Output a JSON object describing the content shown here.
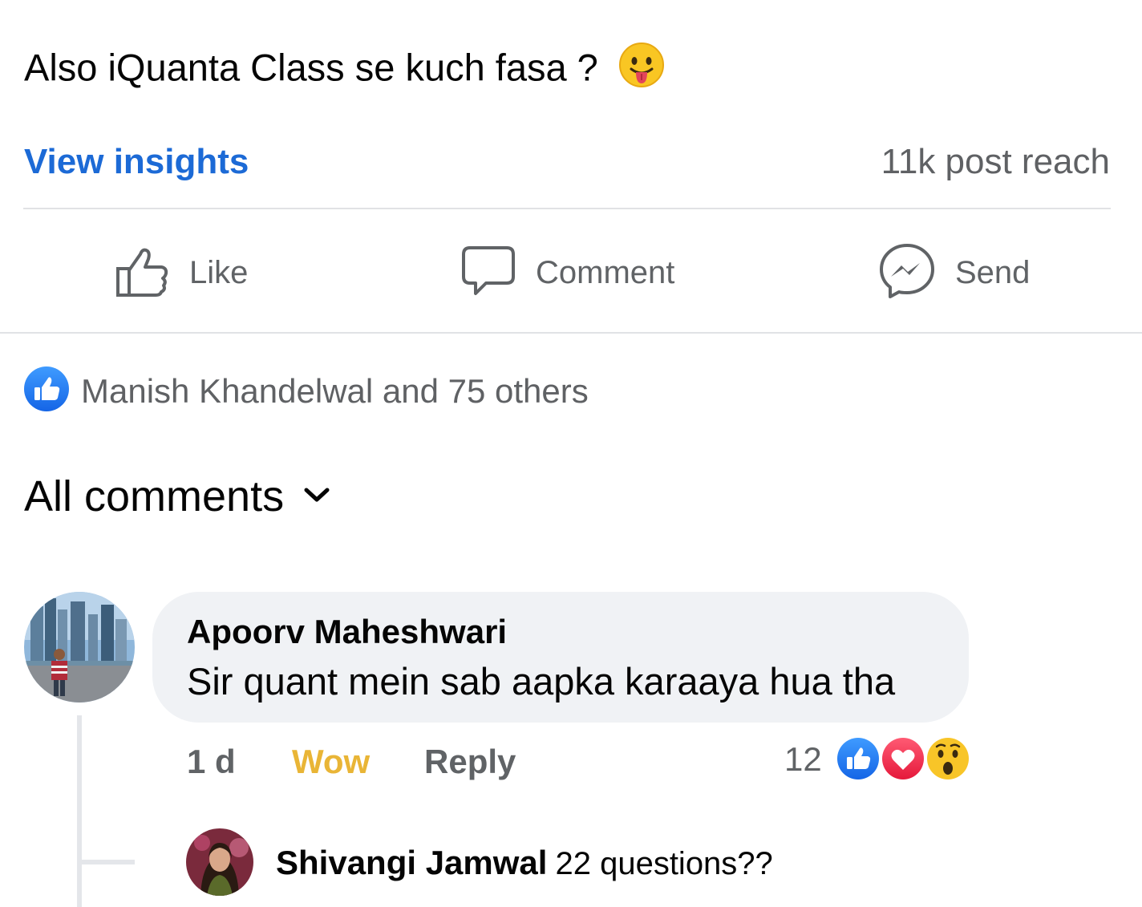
{
  "post": {
    "text": "Also iQuanta Class se kuch fasa ?",
    "emoji_icon": "tongue-out-emoji"
  },
  "insights": {
    "link_label": "View insights",
    "reach": "11k post reach"
  },
  "actions": {
    "like": "Like",
    "comment": "Comment",
    "send": "Send"
  },
  "reactions_summary": {
    "icon": "like-reaction-icon",
    "text": "Manish Khandelwal and 75 others"
  },
  "comments_filter": {
    "label": "All comments"
  },
  "comment": {
    "author": "Apoorv Maheshwari",
    "text": "Sir quant mein sab aapka karaaya hua tha",
    "time": "1 d",
    "reaction_label": "Wow",
    "reply_label": "Reply",
    "reaction_count": "12",
    "reaction_icons": [
      "like-reaction-icon",
      "love-reaction-icon",
      "wow-reaction-icon"
    ]
  },
  "reply": {
    "author": "Shivangi Jamwal",
    "text": "22 questions??"
  },
  "colors": {
    "link_blue": "#1c6ad6",
    "wow_yellow": "#e9b536",
    "bubble_bg": "#f0f2f5",
    "secondary_text": "#606366"
  }
}
